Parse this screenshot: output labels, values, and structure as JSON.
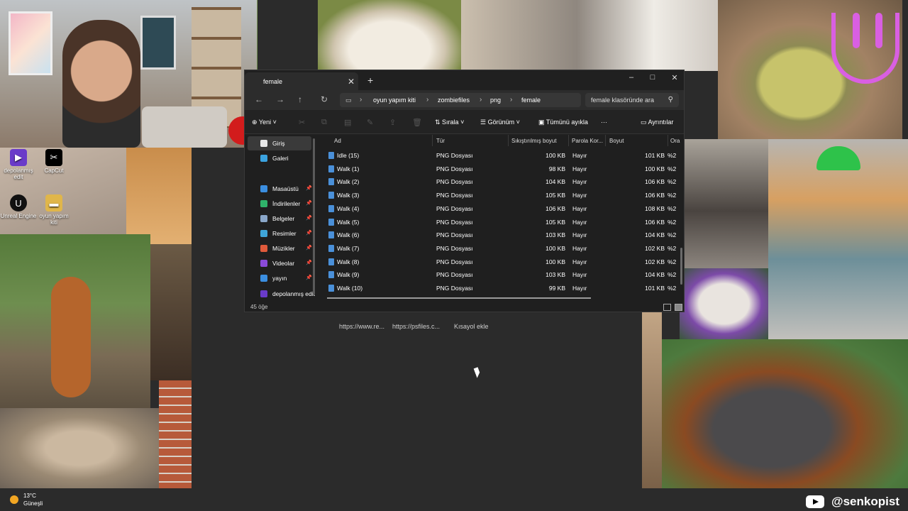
{
  "desktop_icons": [
    {
      "label": "depolanmış edit",
      "color": "#6a3bc9",
      "glyph": "▶"
    },
    {
      "label": "CapCut",
      "color": "#000000",
      "glyph": "✂"
    },
    {
      "label": "Unreal Engine",
      "color": "#111111",
      "glyph": "U"
    },
    {
      "label": "oyun yapım kiti",
      "color": "#e0b64a",
      "glyph": "▬"
    }
  ],
  "background_shortcuts": [
    "https://www.re...",
    "https://psfiles.c...",
    "Kısayol ekle"
  ],
  "explorer": {
    "tab_title": "female",
    "window_controls": {
      "minimize": "–",
      "maximize": "□",
      "close": "✕"
    },
    "breadcrumbs": [
      "oyun yapım kiti",
      "zombiefiles",
      "png",
      "female"
    ],
    "search_placeholder": "female klasöründe ara",
    "toolbar": {
      "new_label": "Yeni",
      "sort_label": "Sırala",
      "view_label": "Görünüm",
      "select_all_label": "Tümünü ayıkla",
      "more_label": "···",
      "details_label": "Ayrıntılar"
    },
    "sidebar": [
      {
        "label": "Giriş",
        "color": "#e8e8e8",
        "pinned": false,
        "selected": true
      },
      {
        "label": "Galeri",
        "color": "#3ba3e0",
        "pinned": false,
        "selected": false
      },
      {
        "label": "Masaüstü",
        "color": "#3b8ee0",
        "pinned": true,
        "selected": false
      },
      {
        "label": "İndirilenler",
        "color": "#2fb36a",
        "pinned": true,
        "selected": false
      },
      {
        "label": "Belgeler",
        "color": "#8aa7c9",
        "pinned": true,
        "selected": false
      },
      {
        "label": "Resimler",
        "color": "#3fa6d9",
        "pinned": true,
        "selected": false
      },
      {
        "label": "Müzikler",
        "color": "#e05a3b",
        "pinned": true,
        "selected": false
      },
      {
        "label": "Videolar",
        "color": "#8a4ad9",
        "pinned": true,
        "selected": false
      },
      {
        "label": "yayın",
        "color": "#3b8ee0",
        "pinned": true,
        "selected": false
      },
      {
        "label": "depolanmış edit",
        "color": "#6a3bc9",
        "pinned": false,
        "selected": false
      }
    ],
    "columns": [
      "Ad",
      "Tür",
      "Sıkıştırılmış boyut",
      "Parola Kor...",
      "Boyut",
      "Ora"
    ],
    "files": [
      {
        "name": "Idle (15)",
        "type": "PNG Dosyası",
        "compressed": "100 KB",
        "protected": "Hayır",
        "size": "101 KB",
        "ratio": "%2"
      },
      {
        "name": "Walk (1)",
        "type": "PNG Dosyası",
        "compressed": "98 KB",
        "protected": "Hayır",
        "size": "100 KB",
        "ratio": "%2"
      },
      {
        "name": "Walk (2)",
        "type": "PNG Dosyası",
        "compressed": "104 KB",
        "protected": "Hayır",
        "size": "106 KB",
        "ratio": "%2"
      },
      {
        "name": "Walk (3)",
        "type": "PNG Dosyası",
        "compressed": "105 KB",
        "protected": "Hayır",
        "size": "106 KB",
        "ratio": "%2"
      },
      {
        "name": "Walk (4)",
        "type": "PNG Dosyası",
        "compressed": "106 KB",
        "protected": "Hayır",
        "size": "108 KB",
        "ratio": "%2"
      },
      {
        "name": "Walk (5)",
        "type": "PNG Dosyası",
        "compressed": "105 KB",
        "protected": "Hayır",
        "size": "106 KB",
        "ratio": "%2"
      },
      {
        "name": "Walk (6)",
        "type": "PNG Dosyası",
        "compressed": "103 KB",
        "protected": "Hayır",
        "size": "104 KB",
        "ratio": "%2"
      },
      {
        "name": "Walk (7)",
        "type": "PNG Dosyası",
        "compressed": "100 KB",
        "protected": "Hayır",
        "size": "102 KB",
        "ratio": "%2"
      },
      {
        "name": "Walk (8)",
        "type": "PNG Dosyası",
        "compressed": "100 KB",
        "protected": "Hayır",
        "size": "102 KB",
        "ratio": "%2"
      },
      {
        "name": "Walk (9)",
        "type": "PNG Dosyası",
        "compressed": "103 KB",
        "protected": "Hayır",
        "size": "104 KB",
        "ratio": "%2"
      },
      {
        "name": "Walk (10)",
        "type": "PNG Dosyası",
        "compressed": "99 KB",
        "protected": "Hayır",
        "size": "101 KB",
        "ratio": "%2"
      }
    ],
    "status_count": "45 öğe"
  },
  "weather": {
    "temp": "13°C",
    "condition": "Güneşli"
  },
  "youtube": {
    "handle": "@senkopist"
  },
  "colors": {
    "window_bg": "#1f1f1f",
    "accent": "#4a90d9",
    "overlay_smile": "#d95fe2"
  }
}
